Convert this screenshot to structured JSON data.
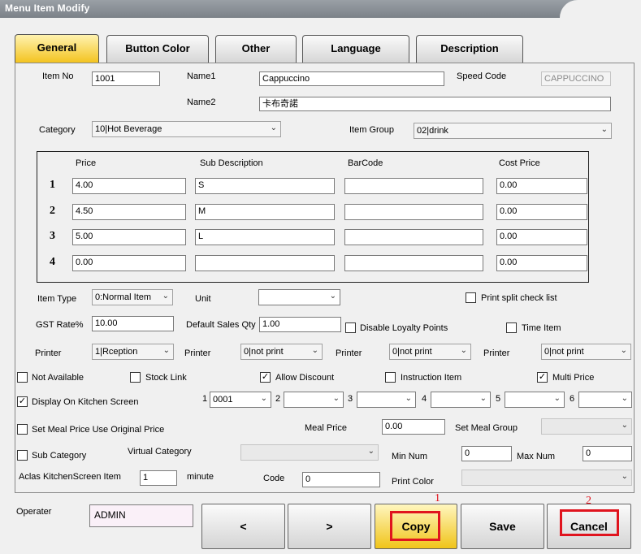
{
  "window": {
    "title": "Menu Item Modify"
  },
  "tabs": [
    "General",
    "Button Color",
    "Other",
    "Language",
    "Description"
  ],
  "item": {
    "item_no_label": "Item No",
    "item_no": "1001",
    "name1_label": "Name1",
    "name1": "Cappuccino",
    "speed_code_label": "Speed Code",
    "speed_code": "CAPPUCCINO",
    "name2_label": "Name2",
    "name2": "卡布奇諾",
    "category_label": "Category",
    "category": "10|Hot Beverage",
    "item_group_label": "Item Group",
    "item_group": "02|drink"
  },
  "price_table": {
    "headers": [
      "Price",
      "Sub Description",
      "BarCode",
      "Cost Price"
    ],
    "rows": [
      {
        "num": "1",
        "price": "4.00",
        "sub": "S",
        "barcode": "",
        "cost": "0.00"
      },
      {
        "num": "2",
        "price": "4.50",
        "sub": "M",
        "barcode": "",
        "cost": "0.00"
      },
      {
        "num": "3",
        "price": "5.00",
        "sub": "L",
        "barcode": "",
        "cost": "0.00"
      },
      {
        "num": "4",
        "price": "0.00",
        "sub": "",
        "barcode": "",
        "cost": "0.00"
      }
    ]
  },
  "options": {
    "item_type_label": "Item Type",
    "item_type": "0:Normal Item",
    "unit_label": "Unit",
    "unit": "",
    "print_split_label": "Print split check list",
    "gst_label": "GST Rate%",
    "gst": "10.00",
    "default_qty_label": "Default Sales Qty",
    "default_qty": "1.00",
    "disable_loyalty_label": "Disable Loyalty Points",
    "time_item_label": "Time Item",
    "printer_label": "Printer",
    "printers": [
      "1|Rception",
      "0|not print",
      "0|not print",
      "0|not print"
    ]
  },
  "checks": {
    "not_available": {
      "label": "Not Available",
      "checked": false
    },
    "stock_link": {
      "label": "Stock Link",
      "checked": false
    },
    "allow_discount": {
      "label": "Allow Discount",
      "checked": true
    },
    "instruction_item": {
      "label": "Instruction Item",
      "checked": false
    },
    "multi_price": {
      "label": "Multi Price",
      "checked": true
    },
    "display_kitchen": {
      "label": "Display On Kitchen Screen",
      "checked": true
    },
    "set_meal_original": {
      "label": "Set Meal Price Use Original Price",
      "checked": false
    },
    "sub_category": {
      "label": "Sub Category",
      "checked": false
    }
  },
  "kitchen": {
    "numbers": [
      "1",
      "2",
      "3",
      "4",
      "5",
      "6"
    ],
    "values": [
      "0001",
      "",
      "",
      "",
      "",
      ""
    ]
  },
  "meal": {
    "meal_price_label": "Meal Price",
    "meal_price": "0.00",
    "set_meal_group_label": "Set Meal Group",
    "set_meal_group": "",
    "virtual_category_label": "Virtual Category",
    "virtual_category": "",
    "min_num_label": "Min Num",
    "min_num": "0",
    "max_num_label": "Max Num",
    "max_num": "0",
    "aclas_label": "Aclas KitchenScreen Item",
    "aclas": "1",
    "minute_label": "minute",
    "code_label": "Code",
    "code": "0",
    "print_color_label": "Print Color",
    "print_color": ""
  },
  "footer": {
    "operator_label": "Operater",
    "operator": "ADMIN",
    "prev_label": "<",
    "next_label": ">",
    "copy_label": "Copy",
    "save_label": "Save",
    "cancel_label": "Cancel",
    "annotation_1": "1",
    "annotation_2": "2"
  },
  "colors": {
    "active_tab": "#f3c21c",
    "highlight": "#e0141e",
    "title_bar": "#8a9096"
  }
}
